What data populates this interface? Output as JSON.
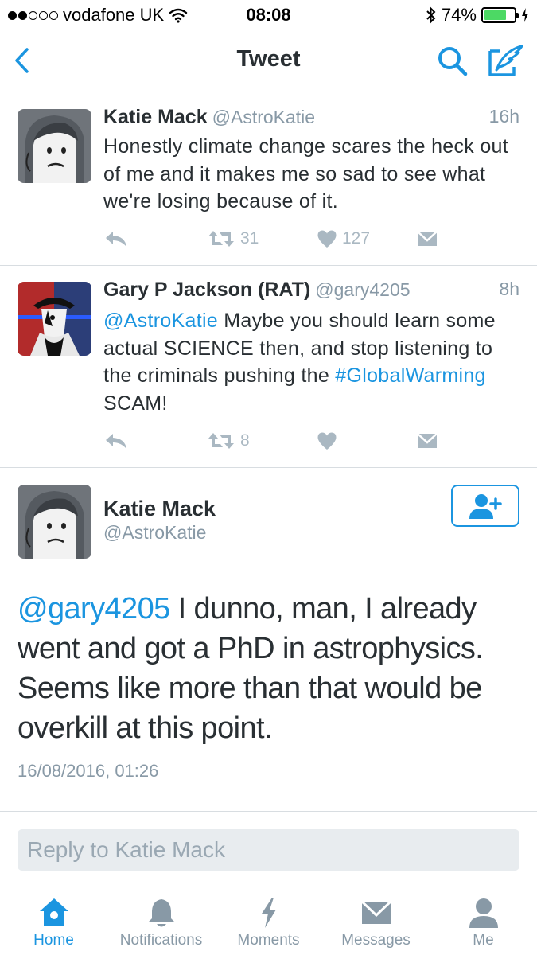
{
  "status_bar": {
    "carrier": "vodafone UK",
    "time": "08:08",
    "battery": "74%",
    "battery_level": 0.74,
    "signal_bars_filled": 2,
    "signal_bars_total": 5
  },
  "nav": {
    "title": "Tweet",
    "back_icon": "chevron-left-icon",
    "search_icon": "search-icon",
    "compose_icon": "compose-icon"
  },
  "thread": [
    {
      "name": "Katie Mack",
      "handle": "@AstroKatie",
      "time": "16h",
      "text": "Honestly climate change scares the heck out of me and it makes me so sad to see what we're losing because of it.",
      "retweets": "31",
      "likes": "127"
    },
    {
      "name": "Gary P Jackson (RAT)",
      "handle": "@gary4205",
      "time": "8h",
      "mention": "@AstroKatie",
      "text_a": " Maybe you should learn some actual SCIENCE then, and stop listening to the criminals pushing the ",
      "hashtag": "#GlobalWarming",
      "text_b": " SCAM!",
      "retweets": "8",
      "likes": ""
    }
  ],
  "main_tweet": {
    "name": "Katie Mack",
    "handle": "@AstroKatie",
    "mention": "@gary4205",
    "text": " I dunno, man, I already went and got a PhD in astrophysics. Seems like more than that would be overkill at this point.",
    "date": "16/08/2016, 01:26"
  },
  "reply": {
    "placeholder": "Reply to Katie Mack"
  },
  "tabs": [
    {
      "label": "Home",
      "icon": "home-icon",
      "active": true
    },
    {
      "label": "Notifications",
      "icon": "bell-icon",
      "active": false
    },
    {
      "label": "Moments",
      "icon": "lightning-icon",
      "active": false
    },
    {
      "label": "Messages",
      "icon": "envelope-icon",
      "active": false
    },
    {
      "label": "Me",
      "icon": "person-icon",
      "active": false
    }
  ],
  "colors": {
    "accent": "#1b95e0",
    "muted": "#8899a6",
    "action_gray": "#aab8c2",
    "text": "#292f33",
    "battery_green": "#4cd964"
  }
}
